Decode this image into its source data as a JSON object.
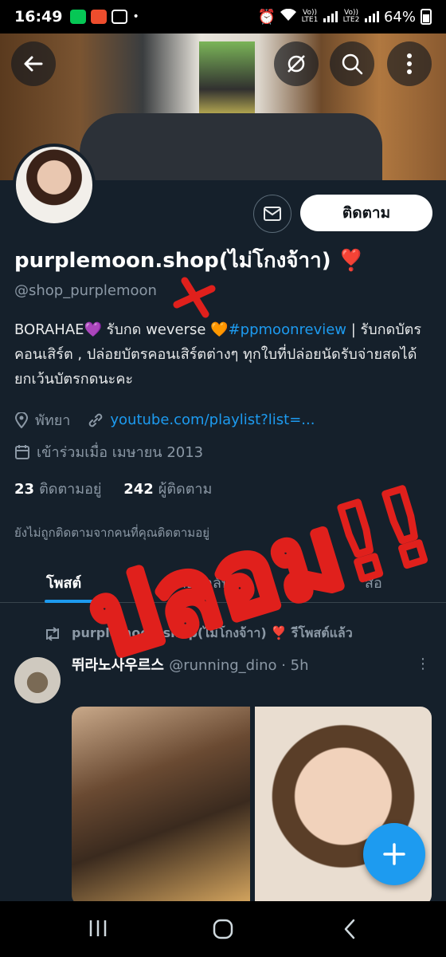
{
  "status_bar": {
    "time": "16:49",
    "battery": "64%",
    "sim1": "Vo)) LTE1",
    "sim2": "Vo)) LTE2"
  },
  "header": {
    "back_icon": "arrow-left-icon",
    "icons": [
      "no-sync-icon",
      "search-icon",
      "more-vertical-icon"
    ]
  },
  "profile": {
    "display_name": "purplemoon.shop(ไม่โกงจ้าา)",
    "name_emoji": "❣️",
    "handle": "@shop_purplemoon",
    "bio_part1": "BORAHAE",
    "bio_heart1": "💜",
    "bio_part2": " รับกด weverse ",
    "bio_heart2": "🧡",
    "bio_hashtag": "#ppmoonreview",
    "bio_part3": " | รับกดบัตรคอนเสิร์ต , ปล่อยบัตรคอนเสิร์ตต่างๆ ทุกใบที่ปล่อยนัดรับจ่ายสดได้ยกเว้นบัตรกดนะคะ",
    "location": "พัทยา",
    "website": "youtube.com/playlist?list=...",
    "joined": "เข้าร่วมเมื่อ เมษายน 2013",
    "following_count": "23",
    "following_label": "ติดตามอยู่",
    "followers_count": "242",
    "followers_label": "ผู้ติดตาม",
    "followers_note": "ยังไม่ถูกติดตามจากคนที่คุณติดตามอยู่",
    "follow_button": "ติดตาม"
  },
  "tabs": [
    {
      "label": "โพสต์"
    },
    {
      "label": "ตอบกลับ"
    },
    {
      "label": "สื่อ"
    }
  ],
  "timeline": {
    "repost_by": "purplemoon.shop(ไม่โกงจ้าา) ❣️ รีโพสต์แล้ว",
    "author_name": "뛰라노사우르스",
    "author_handle": "@running_dino · 5h",
    "more": "⋮"
  },
  "annotation": {
    "handwritten_text": "ปลอม!!",
    "color": "#e0201c"
  },
  "colors": {
    "background": "#15202b",
    "accent": "#1d9bf0",
    "muted": "#8b98a5"
  }
}
